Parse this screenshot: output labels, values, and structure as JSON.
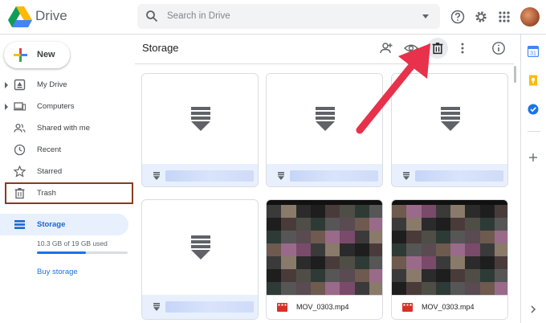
{
  "header": {
    "app_name": "Drive",
    "search_placeholder": "Search in Drive"
  },
  "sidebar": {
    "new_label": "New",
    "items": [
      {
        "label": "My Drive",
        "icon": "my-drive-icon",
        "expandable": true
      },
      {
        "label": "Computers",
        "icon": "computers-icon",
        "expandable": true
      },
      {
        "label": "Shared with me",
        "icon": "shared-icon",
        "expandable": false
      },
      {
        "label": "Recent",
        "icon": "clock-icon",
        "expandable": false
      },
      {
        "label": "Starred",
        "icon": "star-icon",
        "expandable": false
      },
      {
        "label": "Trash",
        "icon": "trash-icon",
        "expandable": false
      }
    ],
    "storage": {
      "label": "Storage",
      "usage_text": "10.3 GB of 19 GB used",
      "usage_fraction": 0.54,
      "buy_label": "Buy storage"
    }
  },
  "main": {
    "title": "Storage",
    "files": [
      {
        "kind": "download",
        "name": ""
      },
      {
        "kind": "download",
        "name": ""
      },
      {
        "kind": "download",
        "name": ""
      },
      {
        "kind": "download",
        "name": ""
      },
      {
        "kind": "video",
        "name": "MOV_0303.mp4"
      },
      {
        "kind": "video",
        "name": "MOV_0303.mp4"
      }
    ]
  },
  "colors": {
    "accent": "#1a73e8",
    "highlight_border": "#8b3a1c",
    "annotation_arrow": "#e8314a"
  }
}
